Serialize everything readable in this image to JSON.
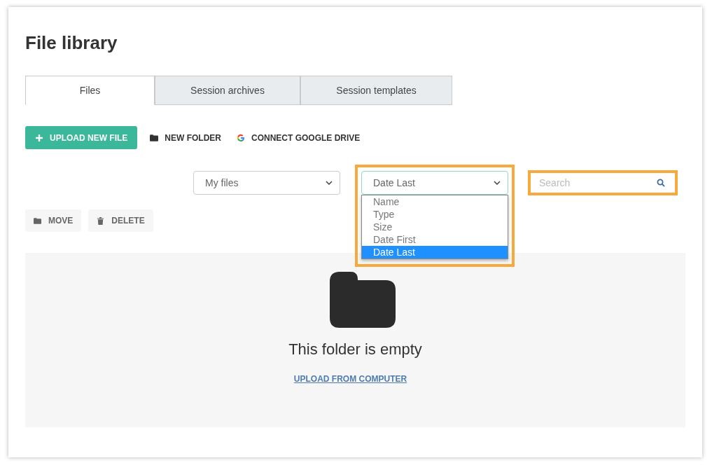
{
  "title": "File library",
  "tabs": [
    {
      "label": "Files",
      "selected": true
    },
    {
      "label": "Session archives",
      "selected": false
    },
    {
      "label": "Session templates",
      "selected": false
    }
  ],
  "actions": [
    {
      "kind": "primary",
      "label": "UPLOAD NEW FILE"
    },
    {
      "kind": "folder",
      "label": "NEW FOLDER"
    },
    {
      "kind": "google",
      "label": "CONNECT GOOGLE DRIVE"
    }
  ],
  "owner_select": {
    "value": "My files"
  },
  "sort_select": {
    "value": "Date Last",
    "highlighted": true,
    "expanded": true,
    "options": [
      {
        "label": "Name",
        "selected": false
      },
      {
        "label": "Type",
        "selected": false
      },
      {
        "label": "Size",
        "selected": false
      },
      {
        "label": "Date First",
        "selected": false
      },
      {
        "label": "Date Last",
        "selected": true
      }
    ]
  },
  "search": {
    "placeholder": "Search",
    "highlighted": true
  },
  "bulk_actions": [
    {
      "kind": "move",
      "label": "MOVE"
    },
    {
      "kind": "delete",
      "label": "DELETE"
    }
  ],
  "empty_state": {
    "message": "This folder is empty",
    "link": "UPLOAD FROM COMPUTER"
  }
}
